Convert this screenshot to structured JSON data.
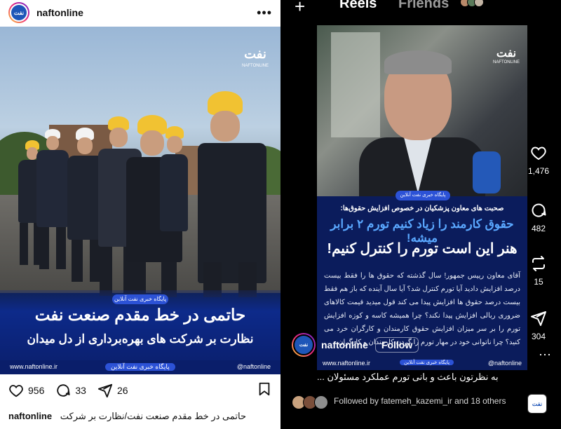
{
  "post": {
    "username": "naftonline",
    "avatar_text": "نفت",
    "logo_mark": "نفت",
    "logo_sub": "NAFTONLINE",
    "overlay_badge": "پایگاه خبری نفت آنلاین",
    "headline": "حاتمی در خط مقدم صنعت نفت",
    "subheadline": "نظارت بر شرکت های بهره‌برداری از دل میدان",
    "footer_web": "www.naftonline.ir",
    "footer_mid": "پایگاه خبری نفت آنلاین",
    "footer_handle": "@naftonline",
    "likes": "956",
    "comments": "33",
    "shares": "26",
    "caption_user": "naftonline",
    "caption_text": "حاتمی در خط مقدم صنعت نفت/نظارت بر شرکت"
  },
  "reels": {
    "tab_reels": "Reels",
    "tab_friends": "Friends",
    "logo_mark": "نفت",
    "logo_sub": "NAFTONLINE",
    "badge": "پایگاه خبری نفت آنلاین",
    "intro": "صحبت های معاون پزشکیان در خصوص افزایش حقوق‌ها:",
    "line1": "حقوق کارمند را زیاد کنیم تورم ۲ برابر میشه!",
    "line2": "هنر این است تورم را کنترل کنیم!",
    "body": "آقای معاون رییس جمهور! سال گذشته که حقوق ها را فقط بیست درصد افزایش دادید آیا تورم کنترل شد؟ آیا سال آینده که باز هم فقط بیست درصد حقوق ها افزایش پیدا می کند قول میدید قیمت کالاهای ضروری ربالی افزایش پیدا نکند؟ چرا همیشه کاسه و کوزه افزایش تورم را بر سر میزان افزایش حقوق کارمندان و کارگران خرد می کنید؟ چرا ناتوانی خود در مهار تورم را گردن کارمندان و کارگران",
    "footer_web": "www.naftonline.ir",
    "footer_mid": "پایگاه خبری نفت آنلاین",
    "footer_handle": "@naftonline",
    "likes": "1,476",
    "comments": "482",
    "reposts": "15",
    "shares": "304",
    "username": "naftonline",
    "follow_label": "Follow",
    "caption": "به نظرتون باعث و بانی تورم عملکرد مسئولان ...",
    "followed_by": "Followed by fatemeh_kazemi_ir and 18 others",
    "avatar_text": "نفت"
  },
  "icons": {
    "heart": "heart-icon",
    "comment": "comment-icon",
    "send": "send-icon",
    "save": "bookmark-icon",
    "repost": "repost-icon",
    "more": "more-icon"
  },
  "colors": {
    "brand_blue": "#0d2a8a",
    "accent_blue": "#2c52d6",
    "highlight": "#5aa8ff"
  }
}
